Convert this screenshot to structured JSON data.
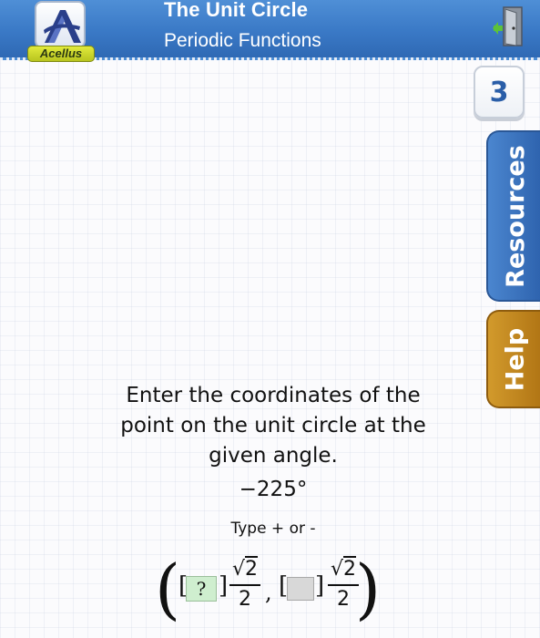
{
  "header": {
    "logo_text": "Acellus",
    "title": "The Unit Circle",
    "subtitle": "Periodic Functions"
  },
  "step_counter": "3",
  "side_tabs": {
    "resources_label": "Resources",
    "help_label": "Help"
  },
  "question": {
    "prompt": "Enter the coordinates of the point on the unit circle at the given angle.",
    "angle": "−225°",
    "instruction": "Type + or -"
  },
  "answer": {
    "box1_value": "?",
    "box2_value": "",
    "frac1": {
      "radical": "√",
      "radicand": "2",
      "denominator": "2"
    },
    "frac2": {
      "radical": "√",
      "radicand": "2",
      "denominator": "2"
    },
    "left_paren": "(",
    "right_paren": ")",
    "bracket_open": "[",
    "bracket_close": "]",
    "comma": ","
  },
  "colors": {
    "header_blue": "#3a79c6",
    "resources_tab": "#2d62ad",
    "help_tab": "#b07414",
    "logo_label": "#c9d32a",
    "answer_box_active": "#cfeecf",
    "answer_box_empty": "#d8d8d8"
  },
  "icons": {
    "logo": "acellus-logo-icon",
    "exit": "exit-door-icon"
  }
}
